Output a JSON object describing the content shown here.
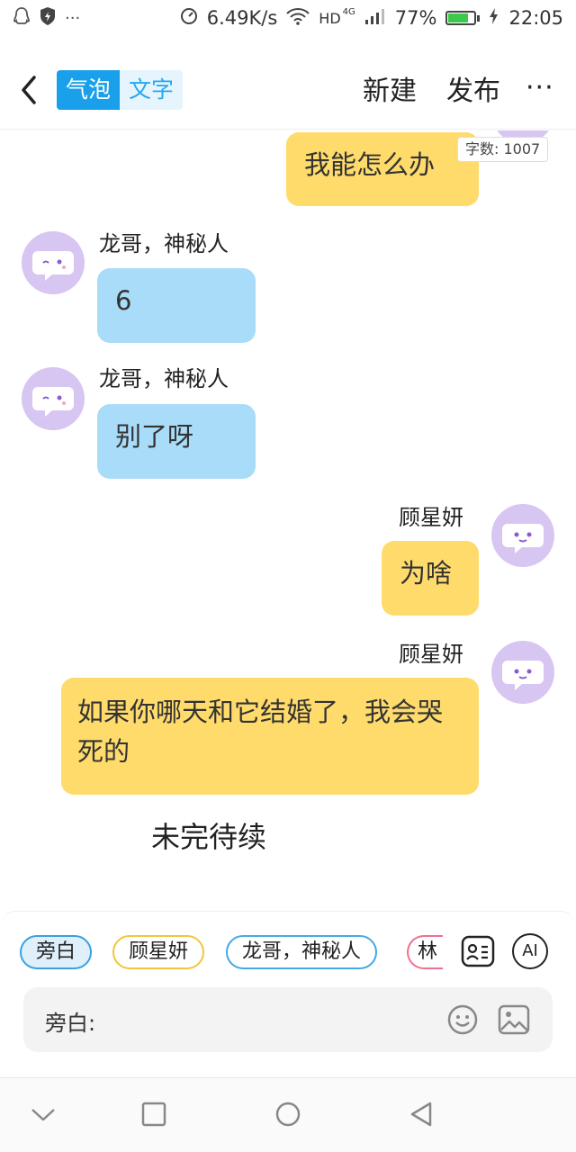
{
  "status_bar": {
    "network_speed": "6.49K/s",
    "network_type": "HD",
    "signal_gen": "4G",
    "battery_percent": "77%",
    "battery_level": 0.77,
    "time": "22:05",
    "left_icons": [
      "qq-icon",
      "shield-icon",
      "more-dots-icon"
    ]
  },
  "header": {
    "toggle_bubble": "气泡",
    "toggle_text": "文字",
    "new_label": "新建",
    "publish_label": "发布",
    "more_label": "···"
  },
  "chat": {
    "word_count": "字数: 1007",
    "messages": [
      {
        "side": "right",
        "speaker": "",
        "text": "我能怎么办",
        "color": "#ffdb6c"
      },
      {
        "side": "left",
        "speaker": "龙哥，神秘人",
        "text": "6",
        "color": "#a9dcf9"
      },
      {
        "side": "left",
        "speaker": "龙哥，神秘人",
        "text": "别了呀",
        "color": "#a9dcf9"
      },
      {
        "side": "right",
        "speaker": "顾星妍",
        "text": "为啥",
        "color": "#ffdb6c"
      },
      {
        "side": "right",
        "speaker": "顾星妍",
        "text": "如果你哪天和它结婚了，我会哭死的",
        "color": "#ffdb6c"
      }
    ],
    "narration": "未完待续"
  },
  "panel": {
    "chips": [
      "旁白",
      "顾星妍",
      "龙哥，神秘人",
      "林"
    ],
    "ai_label": "AI",
    "input_label": "旁白:"
  }
}
